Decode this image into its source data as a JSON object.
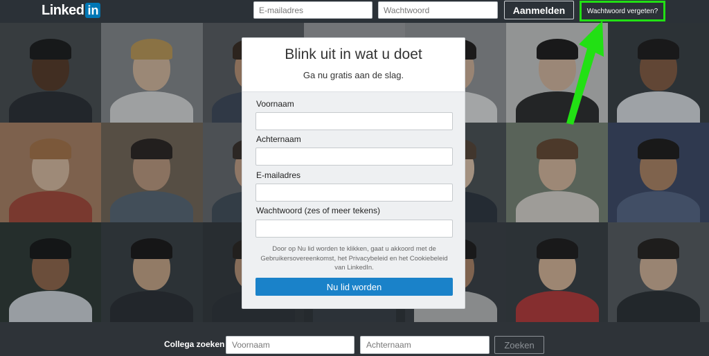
{
  "header": {
    "logo_text": "Linked",
    "logo_in": "in",
    "email_placeholder": "E-mailadres",
    "password_placeholder": "Wachtwoord",
    "login_label": "Aanmelden",
    "forgot_label": "Wachtwoord vergeten?"
  },
  "signup": {
    "title": "Blink uit in wat u doet",
    "subtitle": "Ga nu gratis aan de slag.",
    "first_name_label": "Voornaam",
    "last_name_label": "Achternaam",
    "email_label": "E-mailadres",
    "password_label": "Wachtwoord (zes of meer tekens)",
    "legal_text": "Door op Nu lid worden te klikken, gaat u akkoord met de Gebruikersovereenkomst, het Privacybeleid en het Cookiebeleid van LinkedIn.",
    "join_label": "Nu lid worden"
  },
  "footer": {
    "search_label": "Collega zoeken",
    "first_placeholder": "Voornaam",
    "last_placeholder": "Achternaam",
    "search_button": "Zoeken"
  },
  "colors": {
    "brand_blue": "#0077b5",
    "join_button": "#1a82c9",
    "highlight_green": "#22e014",
    "topbar": "#2b3137"
  },
  "photos": [
    {
      "bg": "#4a4f52",
      "skin": "#5a3a26",
      "hair": "#1a1a1a",
      "shirt": "#2a2d33"
    },
    {
      "bg": "#8c8f93",
      "skin": "#e3c3a6",
      "hair": "#c9a25a",
      "shirt": "#e8e8e8"
    },
    {
      "bg": "#5d6064",
      "skin": "#c79a7a",
      "hair": "#3a2a20",
      "shirt": "#3f4a5c"
    },
    {
      "bg": "#a6a7a9",
      "skin": "#d8b49a",
      "hair": "#2a2624",
      "shirt": "#e5e5e5"
    },
    {
      "bg": "#9a9c9f",
      "skin": "#e0bea2",
      "hair": "#1f1b1a",
      "shirt": "#f0f0f0"
    },
    {
      "bg": "#d6d6d4",
      "skin": "#e4c2a8",
      "hair": "#1c1a1a",
      "shirt": "#2b2b2b"
    },
    {
      "bg": "#3a3f44",
      "skin": "#8a5e42",
      "hair": "#1c1a1a",
      "shirt": "#e8ecf0"
    },
    {
      "bg": "#b58868",
      "skin": "#e8c7aa",
      "hair": "#b27a4a",
      "shirt": "#b04a3a"
    },
    {
      "bg": "#7a6b5a",
      "skin": "#c9a184",
      "hair": "#2a2220",
      "shirt": "#5b6a7a"
    },
    {
      "bg": "#6a6e72",
      "skin": "#cfa88c",
      "hair": "#3a2e28",
      "shirt": "#44505c"
    },
    {
      "bg": "#4f5f4a",
      "skin": "#c89f80",
      "hair": "#2a2420",
      "shirt": "#c04040"
    },
    {
      "bg": "#4e5357",
      "skin": "#f0d1b5",
      "hair": "#5a4536",
      "shirt": "#2d3540"
    },
    {
      "bg": "#7f8a7a",
      "skin": "#e6c3a6",
      "hair": "#6b4a32",
      "shirt": "#e8e2da"
    },
    {
      "bg": "#3e4a6a",
      "skin": "#b98a68",
      "hair": "#1d1a18",
      "shirt": "#5a6a8c"
    },
    {
      "bg": "#2e3a35",
      "skin": "#9a6a4c",
      "hair": "#151414",
      "shirt": "#dfe4ea"
    },
    {
      "bg": "#3a3f44",
      "skin": "#d6b08e",
      "hair": "#171515",
      "shirt": "#2a2d33"
    },
    {
      "bg": "#34383d",
      "skin": "#c39a7c",
      "hair": "#2a2420",
      "shirt": "#2f3439"
    },
    {
      "bg": "#2f3338",
      "skin": "#c9a184",
      "hair": "#1d1a18",
      "shirt": "#3a4048"
    },
    {
      "bg": "#3b4045",
      "skin": "#b88a6a",
      "hair": "#1c1a1a",
      "shirt": "#c7c7c7"
    },
    {
      "bg": "#3a3f44",
      "skin": "#e6c0a0",
      "hair": "#1c1a1a",
      "shirt": "#c23a3a"
    },
    {
      "bg": "#5a5f63",
      "skin": "#e0bea0",
      "hair": "#241f1c",
      "shirt": "#2a2e33"
    }
  ]
}
